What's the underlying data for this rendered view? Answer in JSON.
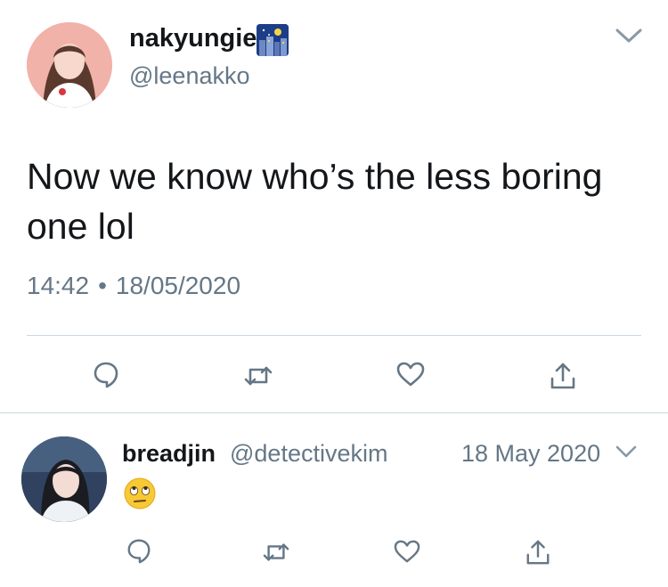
{
  "tweet": {
    "display_name": "nakyungie",
    "name_emoji": "night-city-emoji",
    "handle": "@leenakko",
    "text": "Now we know who’s the less boring one lol",
    "time": "14:42",
    "separator": "•",
    "date": "18/05/2020",
    "actions": [
      "reply-icon",
      "retweet-icon",
      "like-icon",
      "share-icon"
    ]
  },
  "reply": {
    "display_name": "breadjin",
    "handle": "@detectivekim",
    "date": "18 May 2020",
    "emoji": "face-with-rolling-eyes-emoji",
    "actions": [
      "reply-icon",
      "retweet-icon",
      "like-icon",
      "share-icon"
    ]
  },
  "colors": {
    "text_primary": "#14171a",
    "text_secondary": "#657786",
    "divider": "#ccd6dd",
    "icon": "#657786"
  }
}
